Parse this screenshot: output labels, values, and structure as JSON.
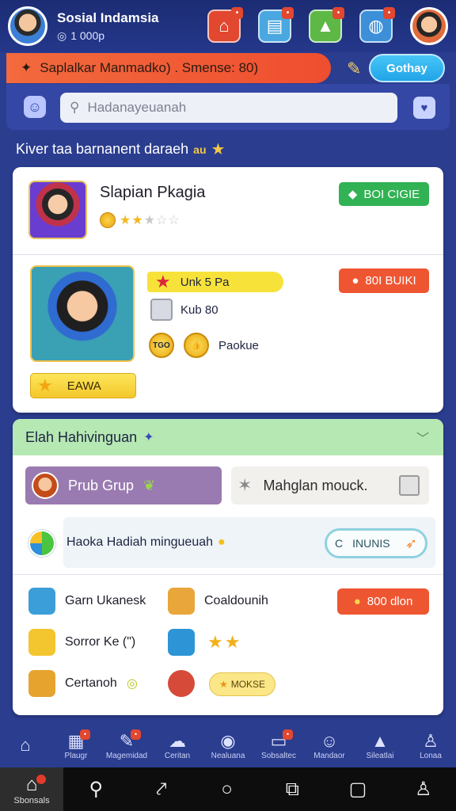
{
  "header": {
    "app_name": "Sosial Indamsia",
    "coin_balance": "1 000p",
    "icons": [
      {
        "name": "home-icon",
        "glyph": "⌂",
        "color": "#e2472f",
        "badge": ""
      },
      {
        "name": "inbox-icon",
        "glyph": "▤",
        "color": "#4aa7e0",
        "badge": ""
      },
      {
        "name": "landscape-icon",
        "glyph": "▲",
        "color": "#5db846",
        "badge": ""
      },
      {
        "name": "shield-icon",
        "glyph": "◍",
        "color": "#3d8fd8",
        "badge": ""
      }
    ]
  },
  "promo": {
    "text": "Saplalkar Manmadko) . Smense: 80)",
    "button": "Gothay"
  },
  "search": {
    "placeholder": "Hadanayeuanah"
  },
  "section_title": {
    "text": "Kiver taa barnanent daraeh",
    "suffix": "au"
  },
  "product1": {
    "title": "Slapian Pkagia",
    "rating_stars": 2,
    "rating_max": 5,
    "button": "BOI CIGIE"
  },
  "product2": {
    "tag": "Unk 5 Pa",
    "button": "80I BUIKI",
    "box_label": "Kub 80",
    "coin_label": "TGO",
    "pack_label": "Paokue",
    "cta": "EAWA"
  },
  "group": {
    "header": "Elah Hahivinguan",
    "group_button": "Prub Grup",
    "second_button": "Mahglan mouck.",
    "hint": "Haoka Hadiah mingueuah",
    "toggle_label": "INUNIS",
    "toggle_prefix": "C",
    "items": [
      {
        "label": "Garn Ukanesk",
        "color": "#3b9ed8"
      },
      {
        "label": "Coaldounih",
        "color": "#e9a63a"
      },
      {
        "label": "Sorror Ke (\")",
        "color": "#f3c52e"
      },
      {
        "label": "",
        "color": "#2d94d6"
      },
      {
        "label": "Certanoh",
        "color": "#e6a42f"
      },
      {
        "label": "",
        "color": "#d64a3a"
      }
    ],
    "price_button": "800 dlon",
    "stars_count": 2,
    "mini_button": "MOKSE"
  },
  "bottom_nav": [
    {
      "icon": "home-icon",
      "glyph": "⌂",
      "label": "",
      "badge": ""
    },
    {
      "icon": "store-icon",
      "glyph": "▦",
      "label": "Plaugr",
      "badge": "•"
    },
    {
      "icon": "edit-icon",
      "glyph": "✎",
      "label": "Magemidad",
      "badge": "•"
    },
    {
      "icon": "cloud-icon",
      "glyph": "☁",
      "label": "Ceritan",
      "badge": ""
    },
    {
      "icon": "palette-icon",
      "glyph": "◉",
      "label": "Nealuana",
      "badge": ""
    },
    {
      "icon": "folder-icon",
      "glyph": "▭",
      "label": "Sobsaltec",
      "badge": "•"
    },
    {
      "icon": "face-icon",
      "glyph": "☺",
      "label": "Mandaor",
      "badge": ""
    },
    {
      "icon": "house-icon",
      "glyph": "▲",
      "label": "Sileatlai",
      "badge": ""
    },
    {
      "icon": "person-icon",
      "glyph": "♙",
      "label": "Lonaa",
      "badge": ""
    }
  ],
  "system_bar": {
    "active_label": "Sbonsals",
    "icons": [
      "search-icon",
      "share-icon",
      "home-circle-icon",
      "screenshot-icon",
      "square-icon",
      "account-icon"
    ]
  }
}
